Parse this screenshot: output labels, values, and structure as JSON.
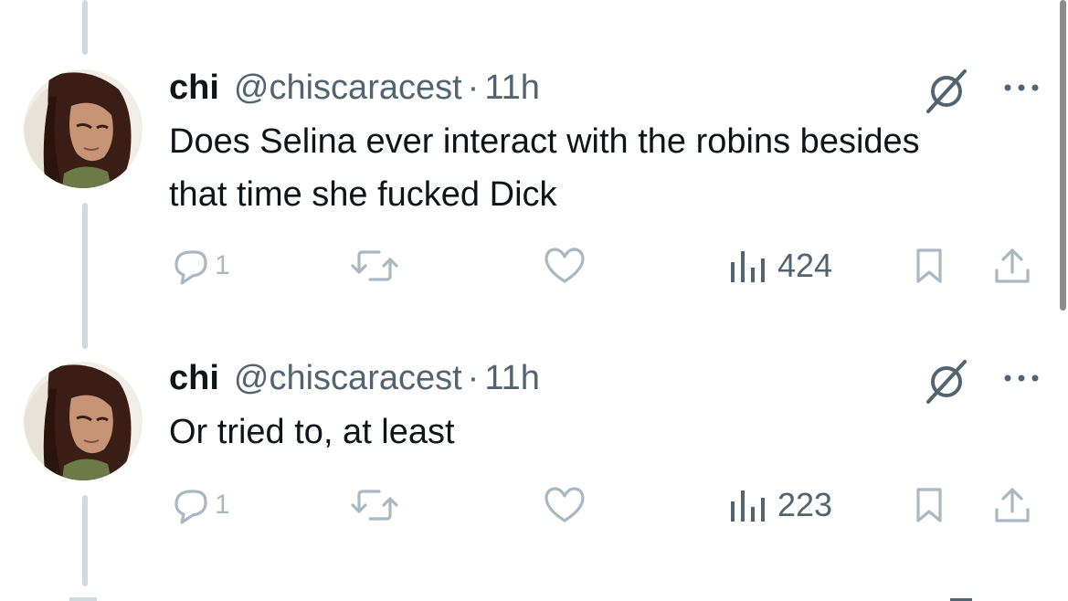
{
  "tweets": [
    {
      "name": "chi",
      "handle": "@chiscaracest",
      "separator": "·",
      "time": "11h",
      "text": "Does Selina ever interact with the robins besides that time she fucked Dick",
      "reply_count": "1",
      "views": "424"
    },
    {
      "name": "chi",
      "handle": "@chiscaracest",
      "separator": "·",
      "time": "11h",
      "text": "Or tried to, at least",
      "reply_count": "1",
      "views": "223"
    }
  ],
  "icons": {
    "reply": "reply-icon",
    "retweet": "retweet-icon",
    "like": "like-icon",
    "views": "views-icon",
    "bookmark": "bookmark-icon",
    "share": "share-icon",
    "grok": "grok-icon",
    "more": "more-icon"
  },
  "colors": {
    "text": "#0f1419",
    "secondary": "#536471",
    "dim_action": "#aab8c2",
    "thread_line": "#cfd9de"
  }
}
